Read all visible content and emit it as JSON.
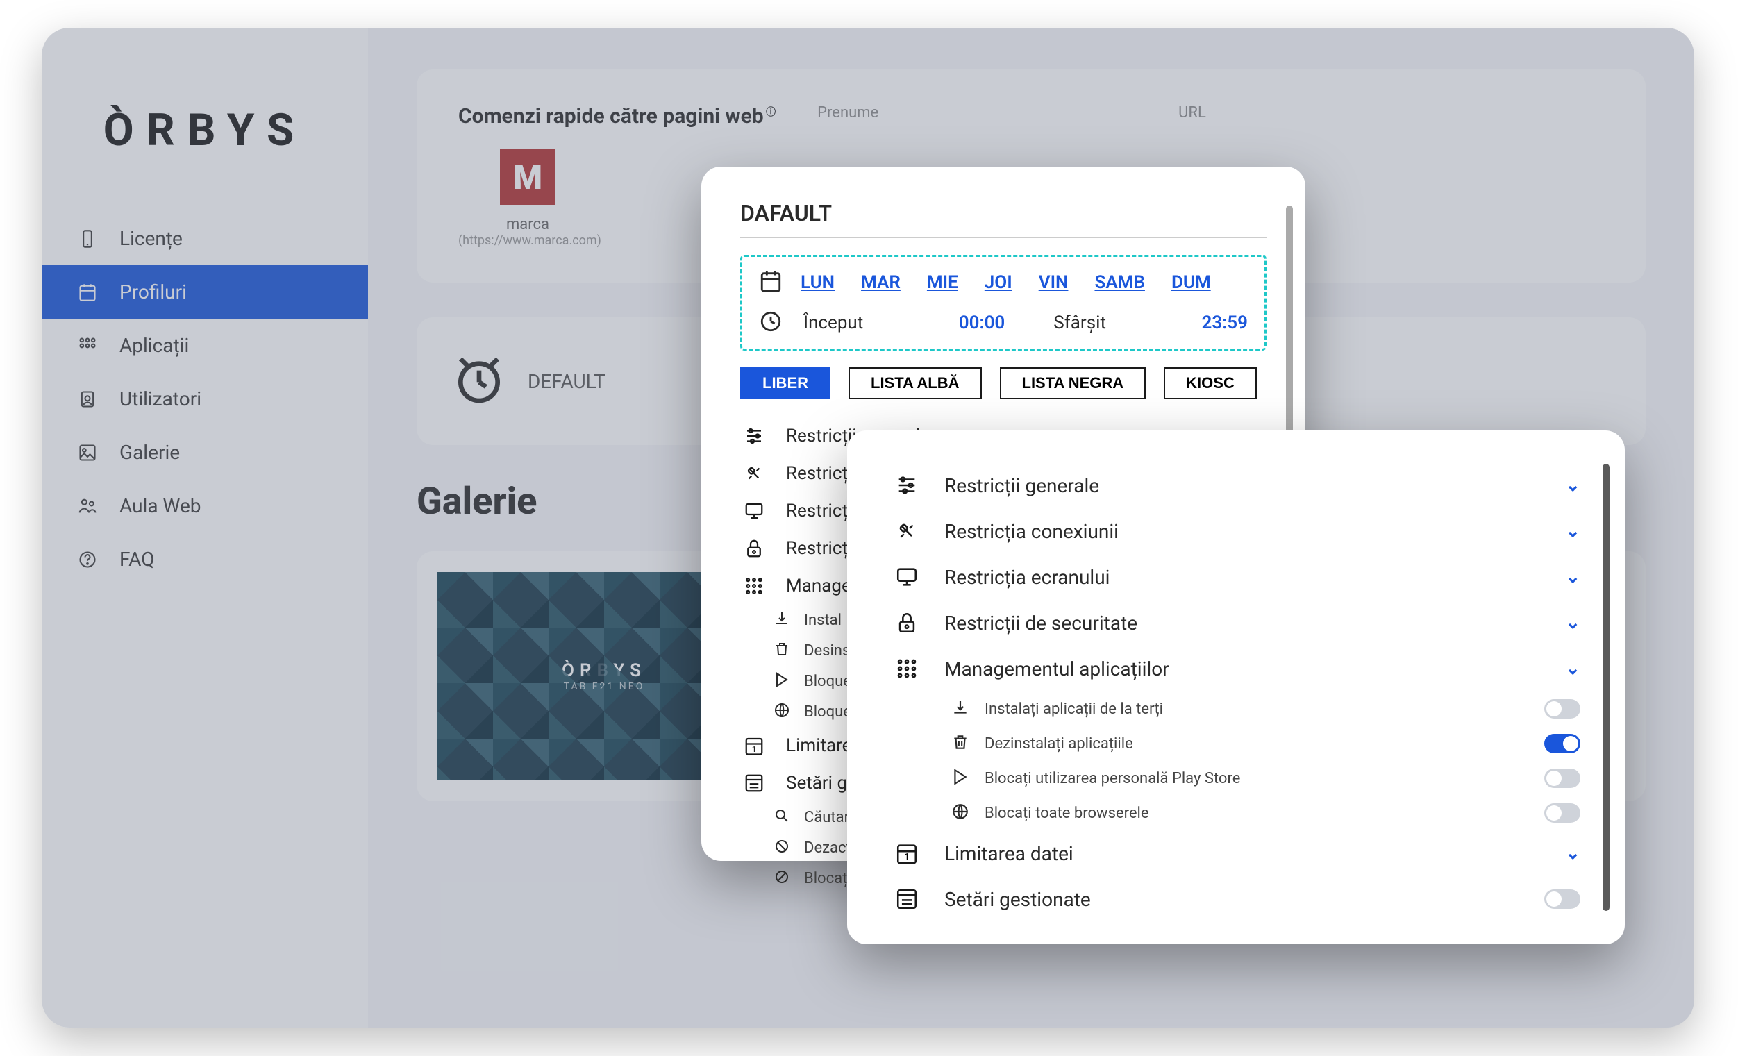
{
  "brand": "ÒRBYS",
  "sidebar": {
    "items": [
      {
        "label": "Licențe"
      },
      {
        "label": "Profiluri"
      },
      {
        "label": "Aplicații"
      },
      {
        "label": "Utilizatori"
      },
      {
        "label": "Galerie"
      },
      {
        "label": "Aula Web"
      },
      {
        "label": "FAQ"
      }
    ]
  },
  "shortcuts": {
    "title": "Comenzi rapide către pagini web",
    "input_prenume": "Prenume",
    "input_url": "URL",
    "item": {
      "name": "marca",
      "url": "(https://www.marca.com)"
    }
  },
  "profile": {
    "name": "DEFAULT"
  },
  "gallery": {
    "title": "Galerie",
    "tile_brand": "ÒRBYS",
    "tile_sub": "TAB F21 NEO"
  },
  "modal1": {
    "title": "DAFAULT",
    "days": [
      "LUN",
      "MAR",
      "MIE",
      "JOI",
      "VIN",
      "SAMB",
      "DUM"
    ],
    "start_label": "Început",
    "start_val": "00:00",
    "end_label": "Sfârșit",
    "end_val": "23:59",
    "modes": [
      "LIBER",
      "LISTA ALBĂ",
      "LISTA NEGRA",
      "KIOSC"
    ],
    "restrictions": [
      "Restricții generale",
      "Restricți",
      "Restricți",
      "Restricți",
      "Manage"
    ],
    "subs": [
      "Instal",
      "Desins",
      "Bloque",
      "Bloque"
    ],
    "bottom": [
      "Limitare",
      "Setări ge"
    ],
    "bsubs": [
      "Căutar",
      "Dezact",
      "Blocaț"
    ]
  },
  "modal2": {
    "sections": [
      {
        "label": "Restricții generale"
      },
      {
        "label": "Restricția conexiunii"
      },
      {
        "label": "Restricția ecranului"
      },
      {
        "label": "Restricții de securitate"
      },
      {
        "label": "Managementul aplicațiilor"
      }
    ],
    "toggles": [
      {
        "label": "Instalați aplicații de la terți",
        "on": false
      },
      {
        "label": "Dezinstalați aplicațiile",
        "on": true
      },
      {
        "label": "Blocați utilizarea personală Play Store",
        "on": false
      },
      {
        "label": "Blocați toate browserele",
        "on": false
      }
    ],
    "bottom": [
      {
        "label": "Limitarea datei",
        "kind": "chevron"
      },
      {
        "label": "Setări gestionate",
        "kind": "toggle",
        "on": false
      }
    ]
  }
}
